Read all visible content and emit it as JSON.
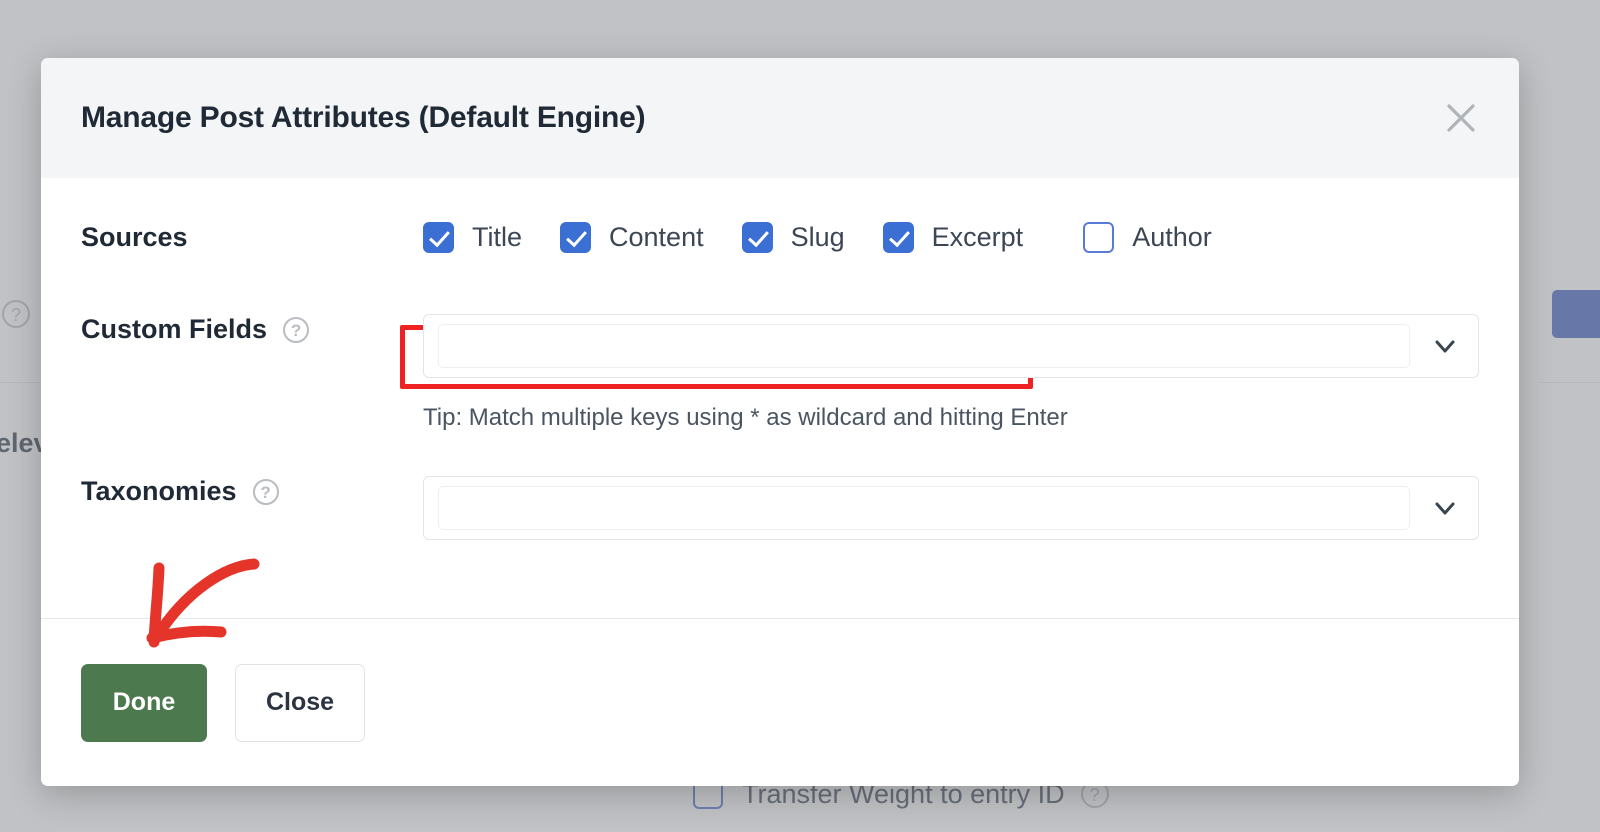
{
  "background": {
    "left_help_icon": "?",
    "left_partial_text": "elev",
    "bottom_row": {
      "checkbox_state": "unchecked",
      "label": "Transfer Weight to entry ID",
      "help_icon": "?"
    }
  },
  "modal": {
    "title": "Manage Post Attributes (Default Engine)",
    "close_icon": "close-icon",
    "sources": {
      "label": "Sources",
      "items": [
        {
          "label": "Title",
          "checked": true
        },
        {
          "label": "Content",
          "checked": true
        },
        {
          "label": "Slug",
          "checked": true
        },
        {
          "label": "Excerpt",
          "checked": true
        },
        {
          "label": "Author",
          "checked": false
        }
      ]
    },
    "custom_fields": {
      "label": "Custom Fields",
      "help_icon": "?",
      "value": "",
      "placeholder": "",
      "tip": "Tip: Match multiple keys using * as wildcard and hitting Enter"
    },
    "taxonomies": {
      "label": "Taxonomies",
      "help_icon": "?",
      "value": "",
      "placeholder": ""
    },
    "footer": {
      "done_label": "Done",
      "close_label": "Close"
    }
  },
  "annotations": {
    "highlight_color": "#ee2222",
    "arrow_color": "#e5342a"
  },
  "colors": {
    "checkbox_checked": "#3b6fd4",
    "done_button": "#4c7a4e",
    "header_background": "#f4f5f6",
    "overlay": "#8c9096"
  }
}
